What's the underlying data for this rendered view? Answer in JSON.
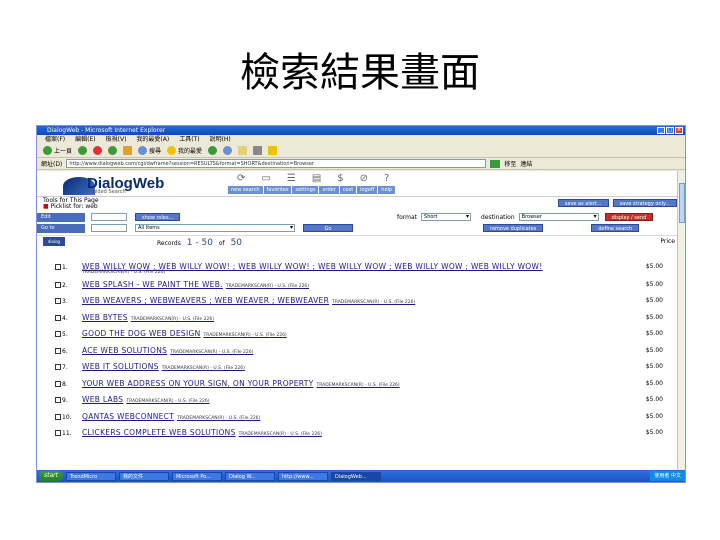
{
  "slide": {
    "title": "檢索結果畫面"
  },
  "browser": {
    "window_title": "DialogWeb - Microsoft Internet Explorer",
    "menu": [
      "檔案(F)",
      "編輯(E)",
      "檢視(V)",
      "我的最愛(A)",
      "工具(T)",
      "說明(H)"
    ],
    "toolbar": {
      "back": "上一頁",
      "search": "搜尋",
      "favorites": "我的最愛"
    },
    "address_label": "網址(D)",
    "address_value": "http://www.dialogweb.com/cgi/dwframe?session=RESULTS&format=SHORT&destination=Browser",
    "go_label": "移至",
    "links_label": "連結"
  },
  "dialogweb": {
    "logo": "DialogWeb",
    "logo_sub": "Guided Search",
    "nav": [
      "new search",
      "favorites",
      "settings",
      "order",
      "cost",
      "logoff",
      "help"
    ],
    "breadcrumb_line1": "Tools for This Page",
    "breadcrumb_line2": "Picklist for: web",
    "btn_save": "save as alert...",
    "btn_save_strategy": "save strategy only...",
    "edit_label": "Edit",
    "show_label": "show roles...",
    "go_to_label": "Go to",
    "select_value": "All Items",
    "go_button": "Go",
    "format_label": "format",
    "format_value": "Short",
    "destination_label": "destination",
    "destination_value": "Browser",
    "display_send": "display / send",
    "remove_dups": "remove duplicates",
    "define_search": "define search",
    "records_label": "Records",
    "records_start": "1 - 50",
    "records_of": "of",
    "records_total": "50",
    "price_label": "Price",
    "dw_logo2": "dialog DIALOG"
  },
  "results": [
    {
      "num": "1.",
      "title": "WEB WILLY WOW ; WEB WILLY WOW! ; WEB WILLY WOW! ; WEB WILLY WOW ; WEB WILLY WOW ; WEB WILLY WOW!",
      "extra": "",
      "sub": "TRADEMARKSCAN(R) - U.S. (File 226)",
      "price": "$5.00"
    },
    {
      "num": "2.",
      "title": "WEB SPLASH - WE PAINT THE WEB.",
      "extra": "TRADEMARKSCAN(R) - U.S. (File 226)",
      "sub": "",
      "price": "$5.00"
    },
    {
      "num": "3.",
      "title": "WEB WEAVERS ; WEBWEAVERS ; WEB WEAVER ; WEBWEAVER",
      "extra": "TRADEMARKSCAN(R) - U.S. (File 226)",
      "sub": "",
      "price": "$5.00"
    },
    {
      "num": "4.",
      "title": "WEB BYTES",
      "extra": "TRADEMARKSCAN(R) - U.S. (File 226)",
      "sub": "",
      "price": "$5.00"
    },
    {
      "num": "5.",
      "title": "GOOD THE DOG WEB DESIGN",
      "extra": "TRADEMARKSCAN(R) - U.S. (File 226)",
      "sub": "",
      "price": "$5.00"
    },
    {
      "num": "6.",
      "title": "ACE WEB SOLUTIONS",
      "extra": "TRADEMARKSCAN(R) - U.S. (File 226)",
      "sub": "",
      "price": "$5.00"
    },
    {
      "num": "7.",
      "title": "WEB IT SOLUTIONS",
      "extra": "TRADEMARKSCAN(R) - U.S. (File 226)",
      "sub": "",
      "price": "$5.00"
    },
    {
      "num": "8.",
      "title": "YOUR WEB ADDRESS ON YOUR SIGN, ON YOUR PROPERTY",
      "extra": "TRADEMARKSCAN(R) - U.S. (File 226)",
      "sub": "",
      "price": "$5.00"
    },
    {
      "num": "9.",
      "title": "WEB LABS",
      "extra": "TRADEMARKSCAN(R) - U.S. (File 226)",
      "sub": "",
      "price": "$5.00"
    },
    {
      "num": "10.",
      "title": "QANTAS WEBCONNECT",
      "extra": "TRADEMARKSCAN(R) - U.S. (File 226)",
      "sub": "",
      "price": "$5.00"
    },
    {
      "num": "11.",
      "title": "CLICKERS COMPLETE WEB SOLUTIONS",
      "extra": "TRADEMARKSCAN(R) - U.S. (File 226)",
      "sub": "",
      "price": "$5.00"
    }
  ],
  "taskbar": {
    "start": "start",
    "tasks": [
      "TrendMicro",
      "我的文件",
      "Microsoft Po...",
      "Dialog W...",
      "http://www...",
      "DialogWeb..."
    ],
    "tray": "使用者 中文"
  }
}
